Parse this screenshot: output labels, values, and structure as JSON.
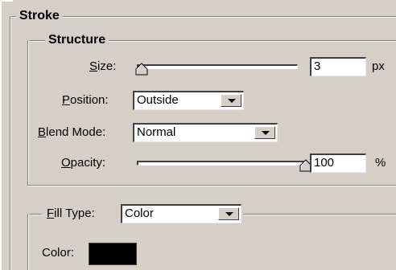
{
  "stroke": {
    "title": "Stroke",
    "structure": {
      "title": "Structure",
      "size": {
        "label": "Size:",
        "underline": "S",
        "rest": "ize:",
        "value": "3",
        "unit": "px",
        "slider_fraction": 0.03
      },
      "position": {
        "label": "Position:",
        "underline": "P",
        "rest": "osition:",
        "selected": "Outside"
      },
      "blend_mode": {
        "label": "Blend Mode:",
        "underline": "B",
        "rest": "lend Mode:",
        "selected": "Normal"
      },
      "opacity": {
        "label": "Opacity:",
        "underline": "O",
        "rest": "pacity:",
        "value": "100",
        "unit": "%",
        "slider_fraction": 1.0
      }
    },
    "fill": {
      "fill_type": {
        "label": "Fill Type:",
        "underline": "F",
        "rest": "ill Type:",
        "selected": "Color"
      },
      "color": {
        "label": "Color:",
        "swatch": "#000000"
      }
    }
  },
  "colors": {
    "panel": "#d4d0c8",
    "shadow": "#808080",
    "highlight": "#ffffff"
  }
}
